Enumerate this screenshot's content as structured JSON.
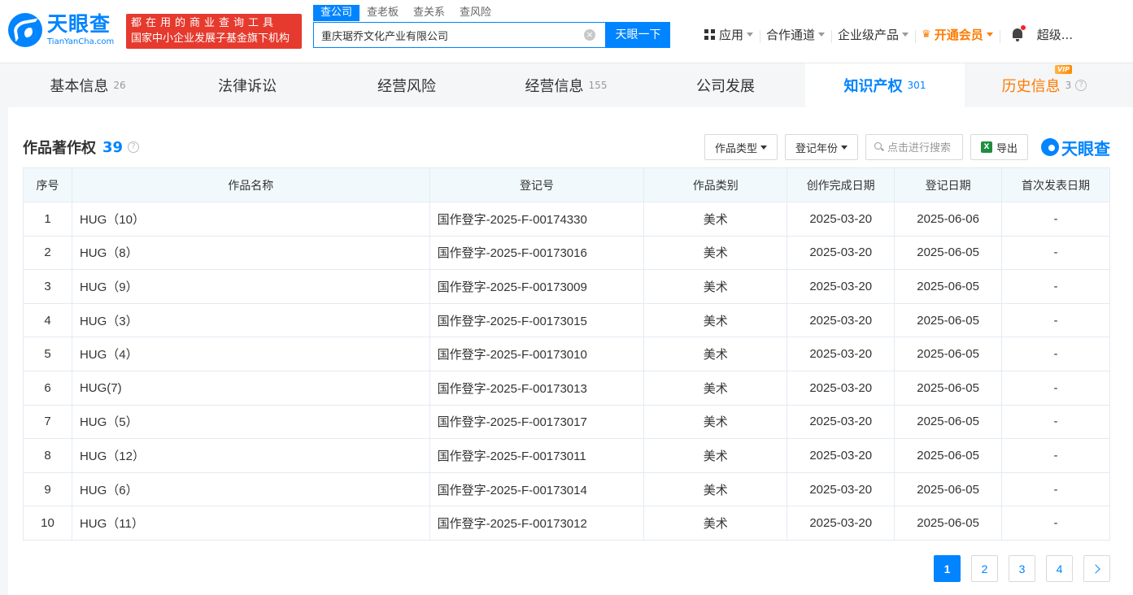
{
  "header": {
    "logo_text": "天眼查",
    "logo_sub": "TianYanCha.com",
    "slogan_line1": "都在用的商业查询工具",
    "slogan_line2": "国家中小企业发展子基金旗下机构",
    "search_tabs": [
      "查公司",
      "查老板",
      "查关系",
      "查风险"
    ],
    "search_value": "重庆琚乔文化产业有限公司",
    "search_button": "天眼一下",
    "nav": {
      "apps": "应用",
      "channels": "合作通道",
      "enterprise": "企业级产品",
      "vip": "开通会员",
      "user": "超级..."
    },
    "accent_color": "#0084ff",
    "vip_color": "#ff7a00"
  },
  "tabs": [
    {
      "label": "基本信息",
      "count": "26"
    },
    {
      "label": "法律诉讼",
      "count": ""
    },
    {
      "label": "经营风险",
      "count": ""
    },
    {
      "label": "经营信息",
      "count": "155"
    },
    {
      "label": "公司发展",
      "count": ""
    },
    {
      "label": "知识产权",
      "count": "301"
    },
    {
      "label": "历史信息",
      "count": "3",
      "badge": "VIP"
    }
  ],
  "section": {
    "title": "作品著作权",
    "count": "39",
    "filters": {
      "type": "作品类型",
      "year": "登记年份",
      "search_placeholder": "点击进行搜索",
      "export": "导出",
      "brand": "天眼查"
    }
  },
  "table": {
    "columns": [
      "序号",
      "作品名称",
      "登记号",
      "作品类别",
      "创作完成日期",
      "登记日期",
      "首次发表日期"
    ],
    "rows": [
      [
        "1",
        "HUG（10）",
        "国作登字-2025-F-00174330",
        "美术",
        "2025-03-20",
        "2025-06-06",
        "-"
      ],
      [
        "2",
        "HUG（8）",
        "国作登字-2025-F-00173016",
        "美术",
        "2025-03-20",
        "2025-06-05",
        "-"
      ],
      [
        "3",
        "HUG（9）",
        "国作登字-2025-F-00173009",
        "美术",
        "2025-03-20",
        "2025-06-05",
        "-"
      ],
      [
        "4",
        "HUG（3）",
        "国作登字-2025-F-00173015",
        "美术",
        "2025-03-20",
        "2025-06-05",
        "-"
      ],
      [
        "5",
        "HUG（4）",
        "国作登字-2025-F-00173010",
        "美术",
        "2025-03-20",
        "2025-06-05",
        "-"
      ],
      [
        "6",
        "HUG(7)",
        "国作登字-2025-F-00173013",
        "美术",
        "2025-03-20",
        "2025-06-05",
        "-"
      ],
      [
        "7",
        "HUG（5）",
        "国作登字-2025-F-00173017",
        "美术",
        "2025-03-20",
        "2025-06-05",
        "-"
      ],
      [
        "8",
        "HUG（12）",
        "国作登字-2025-F-00173011",
        "美术",
        "2025-03-20",
        "2025-06-05",
        "-"
      ],
      [
        "9",
        "HUG（6）",
        "国作登字-2025-F-00173014",
        "美术",
        "2025-03-20",
        "2025-06-05",
        "-"
      ],
      [
        "10",
        "HUG（11）",
        "国作登字-2025-F-00173012",
        "美术",
        "2025-03-20",
        "2025-06-05",
        "-"
      ]
    ]
  },
  "pagination": {
    "pages": [
      "1",
      "2",
      "3",
      "4"
    ],
    "current": "1"
  }
}
